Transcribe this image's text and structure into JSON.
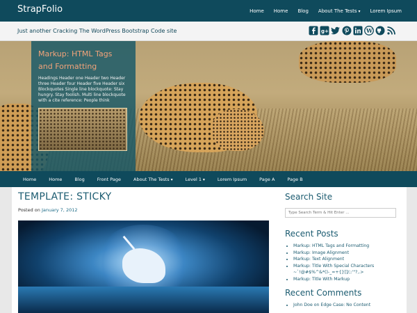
{
  "site": {
    "title": "StrapFolio",
    "tagline": "Just another Cracking The WordPress Bootstrap Code site"
  },
  "top_nav": [
    "Home",
    "Home",
    "Blog",
    "About The Tests",
    "Lorem Ipsum"
  ],
  "social_icons": [
    "facebook-icon",
    "google-plus-icon",
    "twitter-icon",
    "pinterest-icon",
    "linkedin-icon",
    "wordpress-icon",
    "github-icon",
    "rss-icon"
  ],
  "colors": {
    "brand": "#0f4a5c",
    "accent_title": "#f2a37a",
    "link": "#1b5b70"
  },
  "featured": {
    "title": "Markup: HTML Tags and Formatting",
    "excerpt": "Headings Header one Header two Header three Header four Header five Header six Blockquotes Single line blockquote: Stay hungry. Stay foolish. Multi line blockquote with a cite reference: People think"
  },
  "main_nav": [
    "Home",
    "Home",
    "Blog",
    "Front Page",
    "About The Tests",
    "Level 1",
    "Lorem Ipsum",
    "Page A",
    "Page B"
  ],
  "post": {
    "title": "TEMPLATE: STICKY",
    "posted_on_label": "Posted on",
    "date": "January 7, 2012"
  },
  "sidebar": {
    "search_title": "Search Site",
    "search_placeholder": "Type Search Term & Hit Enter ...",
    "recent_posts_title": "Recent Posts",
    "recent_posts": [
      "Markup: HTML Tags and Formatting",
      "Markup: Image Alignment",
      "Markup: Text Alignment",
      "Markup: Title With Special Characters ~`!@#$%^&*()-_=+{}[]/;:'\"?,.>",
      "Markup: Title With Markup"
    ],
    "recent_comments_title": "Recent Comments",
    "recent_comments": [
      "John Doe on Edge Case: No Content"
    ]
  }
}
